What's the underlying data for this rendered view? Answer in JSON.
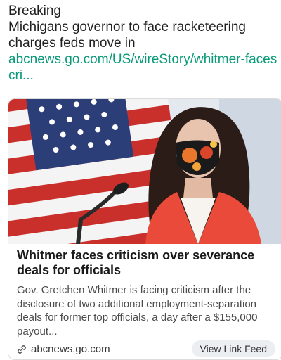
{
  "post": {
    "line1": "Breaking",
    "line2": "Michigans governor to face racketeering",
    "line3": "charges feds move in",
    "link_line1": "abcnews.go.com/US/wireStory/whitmer-faces-",
    "link_line2": "cri..."
  },
  "card": {
    "title": "Whitmer faces criticism over severance deals for officials",
    "description": "Gov. Gretchen Whitmer is facing criticism after the disclosure of two additional employment-separation deals for former top officials, a day after a $155,000 payout...",
    "source": "abcnews.go.com",
    "source_icon": "link-icon",
    "button_label": "View Link Feed"
  },
  "colors": {
    "link": "#0a9a7a",
    "flag_red": "#c9302c",
    "jacket": "#e94a3a"
  }
}
